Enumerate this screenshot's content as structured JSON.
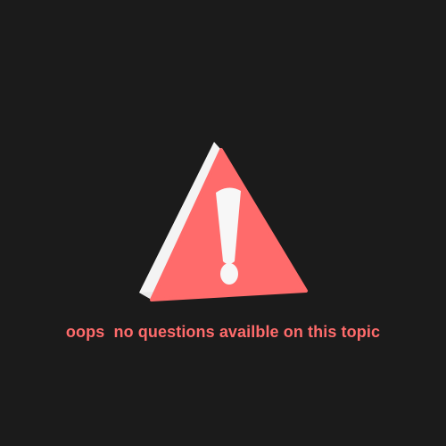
{
  "empty_state": {
    "message": "oops  no questions availble on this topic",
    "icon": "warning-triangle-icon",
    "colors": {
      "background": "#1b1b1b",
      "message": "#ff6b6b",
      "triangle_face": "#ff6b6b",
      "triangle_edge": "#f4f4f4",
      "exclamation": "#f7f7f7"
    }
  }
}
